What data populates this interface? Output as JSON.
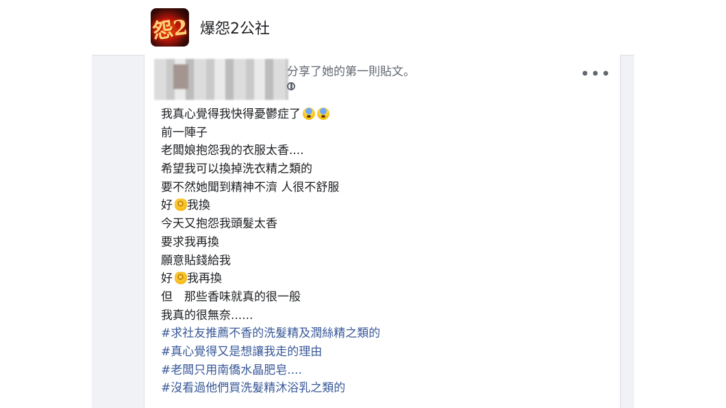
{
  "group": {
    "name": "爆怨2公社",
    "avatar_text": "怨2"
  },
  "post": {
    "shared_text": "分享了她的第一則貼文。",
    "more_label": "•••",
    "lines": [
      "我真心覺得我快得憂鬱症了",
      "前一陣子",
      "老闆娘抱怨我的衣服太香....",
      "希望我可以換掉洗衣精之類的",
      "要不然她聞到精神不濟 人很不舒服",
      "好",
      "我換",
      "今天又抱怨我頭髮太香",
      "要求我再換",
      "願意貼錢給我",
      "好",
      "我再換",
      "但　那些香味就真的很一般",
      "我真的很無奈......"
    ],
    "hashtags": [
      "#求社友推薦不香的洗髮精及潤絲精之類的",
      "#真心覺得又是想讓我走的理由",
      "#老闆只用南僑水晶肥皂....",
      "#沒看過他們買洗髮精沐浴乳之類的"
    ]
  },
  "colors": {
    "hashtag": "#385898",
    "text": "#1c1e21",
    "secondary": "#606770",
    "background": "#f0f2f5"
  }
}
